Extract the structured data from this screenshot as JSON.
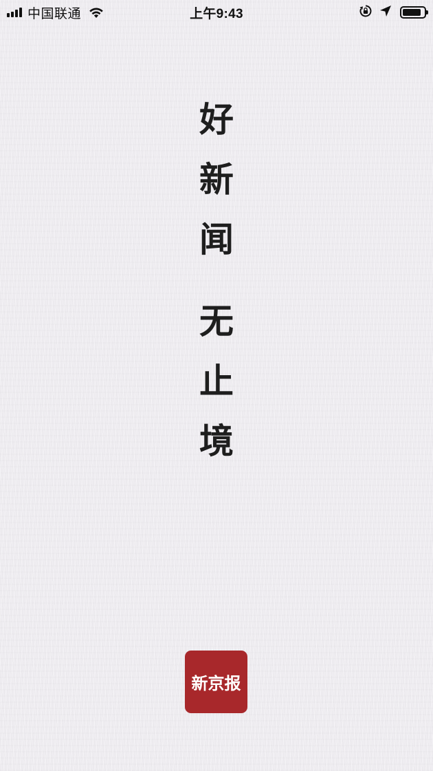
{
  "status_bar": {
    "carrier": "中国联通",
    "time": "上午9:43",
    "signal_bars": 4,
    "battery_level_percent": 86,
    "icons": [
      "signal-icon",
      "wifi-icon",
      "rotation-lock-icon",
      "location-arrow-icon",
      "battery-icon"
    ]
  },
  "slogan": {
    "line1": [
      "好",
      "新",
      "闻"
    ],
    "line2": [
      "无",
      "止",
      "境"
    ]
  },
  "logo": {
    "text": "新京报",
    "color": "#a8282b"
  },
  "colors": {
    "background": "#efedf1",
    "text": "#1e1e1e"
  }
}
